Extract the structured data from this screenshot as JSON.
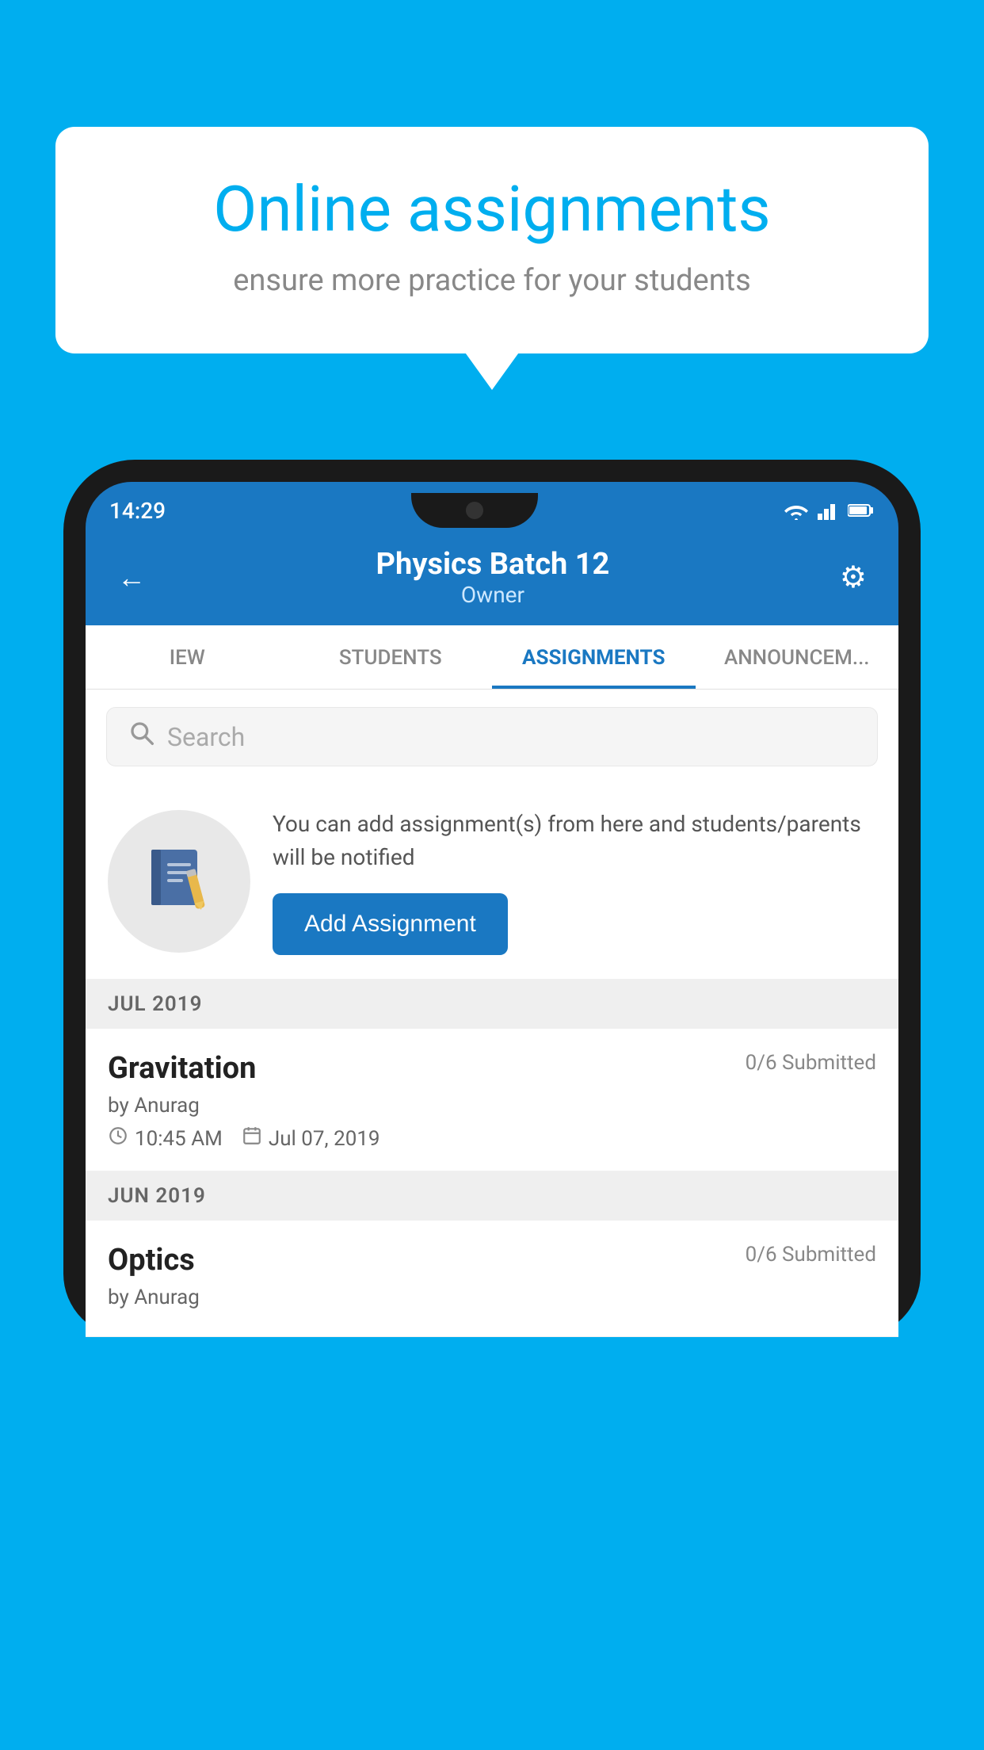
{
  "background_color": "#00AEEF",
  "speech_bubble": {
    "title": "Online assignments",
    "subtitle": "ensure more practice for your students"
  },
  "phone": {
    "status_bar": {
      "time": "14:29"
    },
    "header": {
      "title": "Physics Batch 12",
      "subtitle": "Owner",
      "back_label": "←",
      "settings_label": "⚙"
    },
    "tabs": [
      {
        "label": "IEW",
        "active": false
      },
      {
        "label": "STUDENTS",
        "active": false
      },
      {
        "label": "ASSIGNMENTS",
        "active": true
      },
      {
        "label": "ANNOUNCEM...",
        "active": false
      }
    ],
    "search": {
      "placeholder": "Search"
    },
    "info_card": {
      "description": "You can add assignment(s) from here and students/parents will be notified",
      "add_button_label": "Add Assignment"
    },
    "sections": [
      {
        "month_label": "JUL 2019",
        "assignments": [
          {
            "title": "Gravitation",
            "submitted": "0/6 Submitted",
            "author": "by Anurag",
            "time": "10:45 AM",
            "date": "Jul 07, 2019"
          }
        ]
      },
      {
        "month_label": "JUN 2019",
        "assignments": [
          {
            "title": "Optics",
            "submitted": "0/6 Submitted",
            "author": "by Anurag",
            "time": "",
            "date": ""
          }
        ]
      }
    ]
  }
}
